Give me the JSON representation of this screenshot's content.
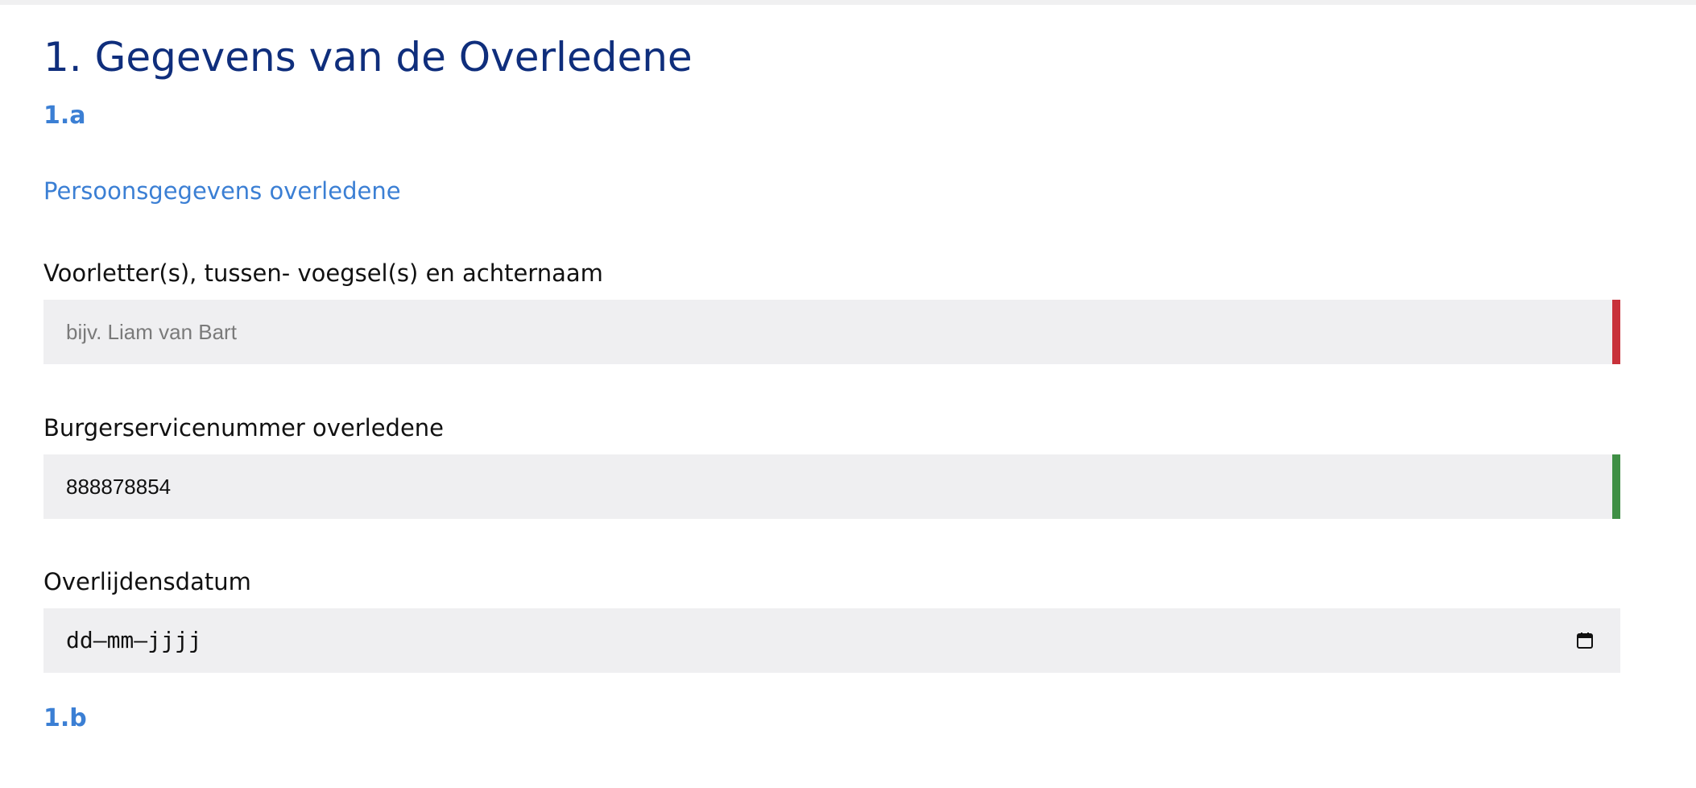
{
  "section": {
    "title": "1. Gegevens van de Overledene",
    "subsection_a_number": "1.a",
    "subsection_a_title": "Persoonsgegevens overledene",
    "subsection_b_number": "1.b"
  },
  "fields": {
    "name": {
      "label": "Voorletter(s), tussen- voegsel(s) en achternaam",
      "value": "",
      "placeholder": "bijv. Liam van Bart",
      "status": "invalid",
      "status_color": "#c8313a"
    },
    "bsn": {
      "label": "Burgerservicenummer overledene",
      "value": "888878854",
      "placeholder": "",
      "status": "valid",
      "status_color": "#3f8f45"
    },
    "date": {
      "label": "Overlijdensdatum",
      "display": "dd–mm–jjjj",
      "icon": "calendar-icon"
    }
  },
  "colors": {
    "title": "#0f2e7c",
    "accent": "#3b7fd4",
    "field_background": "#efeff1"
  }
}
